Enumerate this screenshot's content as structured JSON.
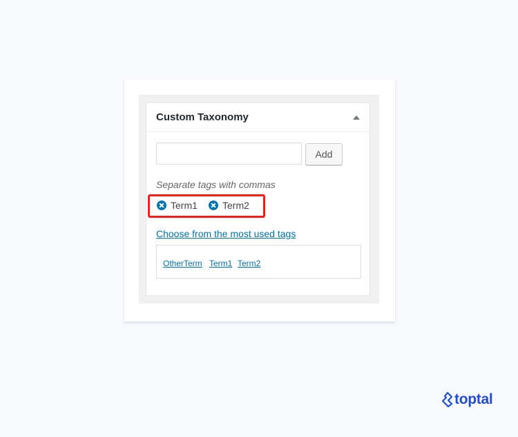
{
  "metabox": {
    "title": "Custom Taxonomy",
    "input": {
      "value": "",
      "placeholder": ""
    },
    "add_button_label": "Add",
    "howto_text": "Separate tags with commas",
    "assigned_tags": [
      {
        "label": "Term1"
      },
      {
        "label": "Term2"
      }
    ],
    "most_used_link": "Choose from the most used tags",
    "tag_cloud": [
      "OtherTerm",
      "Term1",
      "Term2"
    ]
  },
  "highlight_color": "#ff1a1a",
  "link_color": "#0073aa",
  "brand": {
    "name": "toptal",
    "icon": "toptal-logo-icon",
    "color": "#204ecf"
  }
}
